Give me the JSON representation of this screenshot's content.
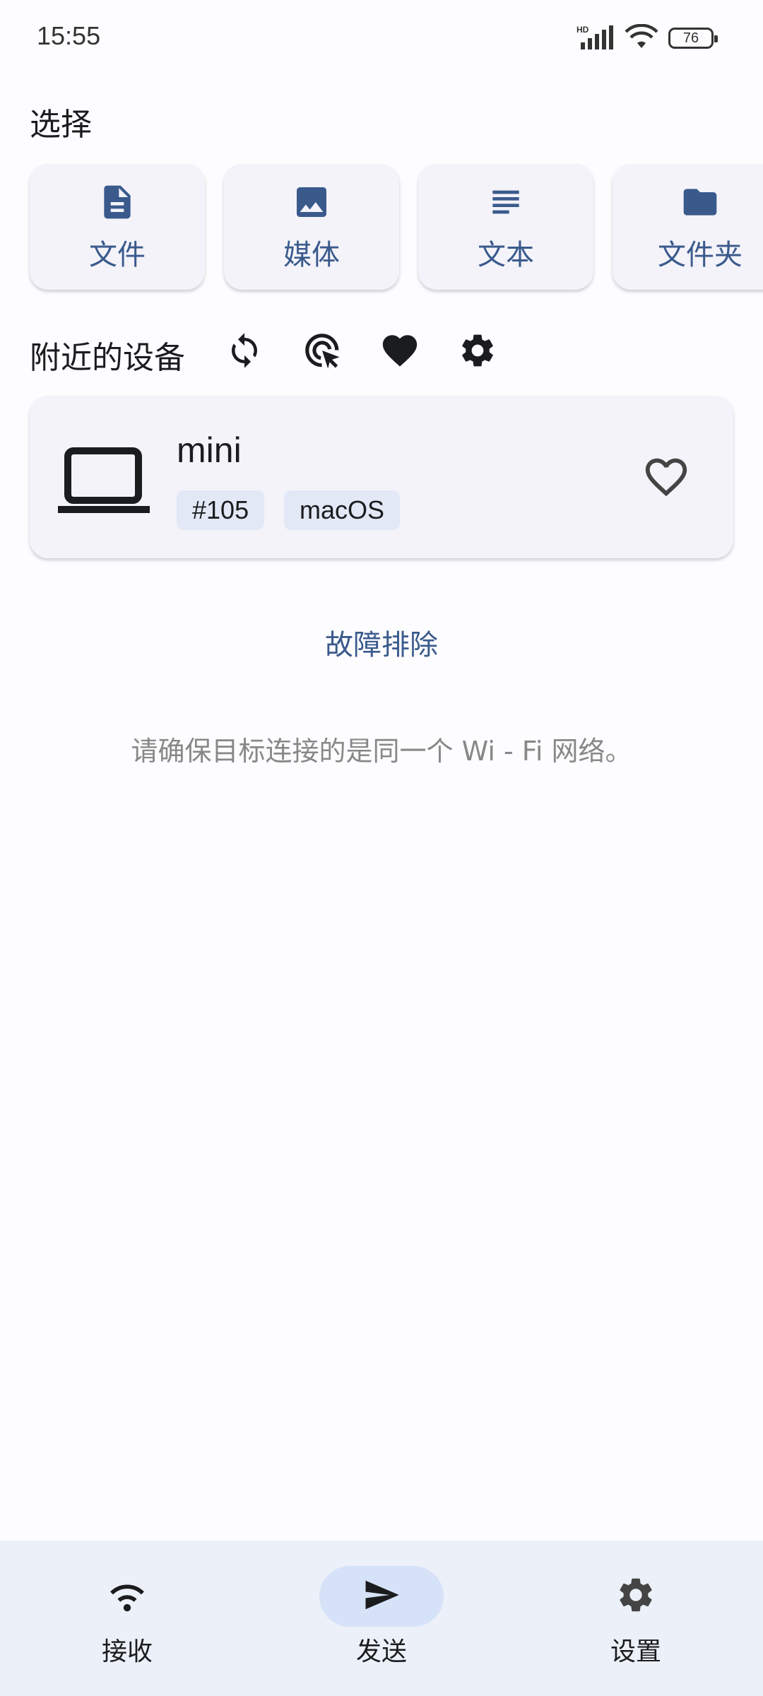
{
  "status": {
    "time": "15:55",
    "battery": "76",
    "network": "HD"
  },
  "select": {
    "title": "选择",
    "items": [
      {
        "label": "文件",
        "icon": "file-icon"
      },
      {
        "label": "媒体",
        "icon": "image-icon"
      },
      {
        "label": "文本",
        "icon": "text-icon"
      },
      {
        "label": "文件夹",
        "icon": "folder-icon"
      }
    ]
  },
  "nearby": {
    "title": "附近的设备",
    "actions": [
      "refresh-icon",
      "target-click-icon",
      "heart-icon",
      "gear-icon"
    ]
  },
  "device": {
    "name": "mini",
    "tags": [
      "#105",
      "macOS"
    ],
    "icon": "laptop-icon"
  },
  "troubleshoot": "故障排除",
  "hint": "请确保目标连接的是同一个 Wi - Fi 网络。",
  "nav": {
    "items": [
      {
        "label": "接收",
        "icon": "wifi-icon",
        "active": false
      },
      {
        "label": "发送",
        "icon": "send-icon",
        "active": true
      },
      {
        "label": "设置",
        "icon": "gear-icon",
        "active": false
      }
    ]
  },
  "colors": {
    "accent": "#3a5a8c",
    "card_bg": "#f3f3f9",
    "nav_bg": "#ecf0f8",
    "active_pill": "#d6e2f7"
  }
}
